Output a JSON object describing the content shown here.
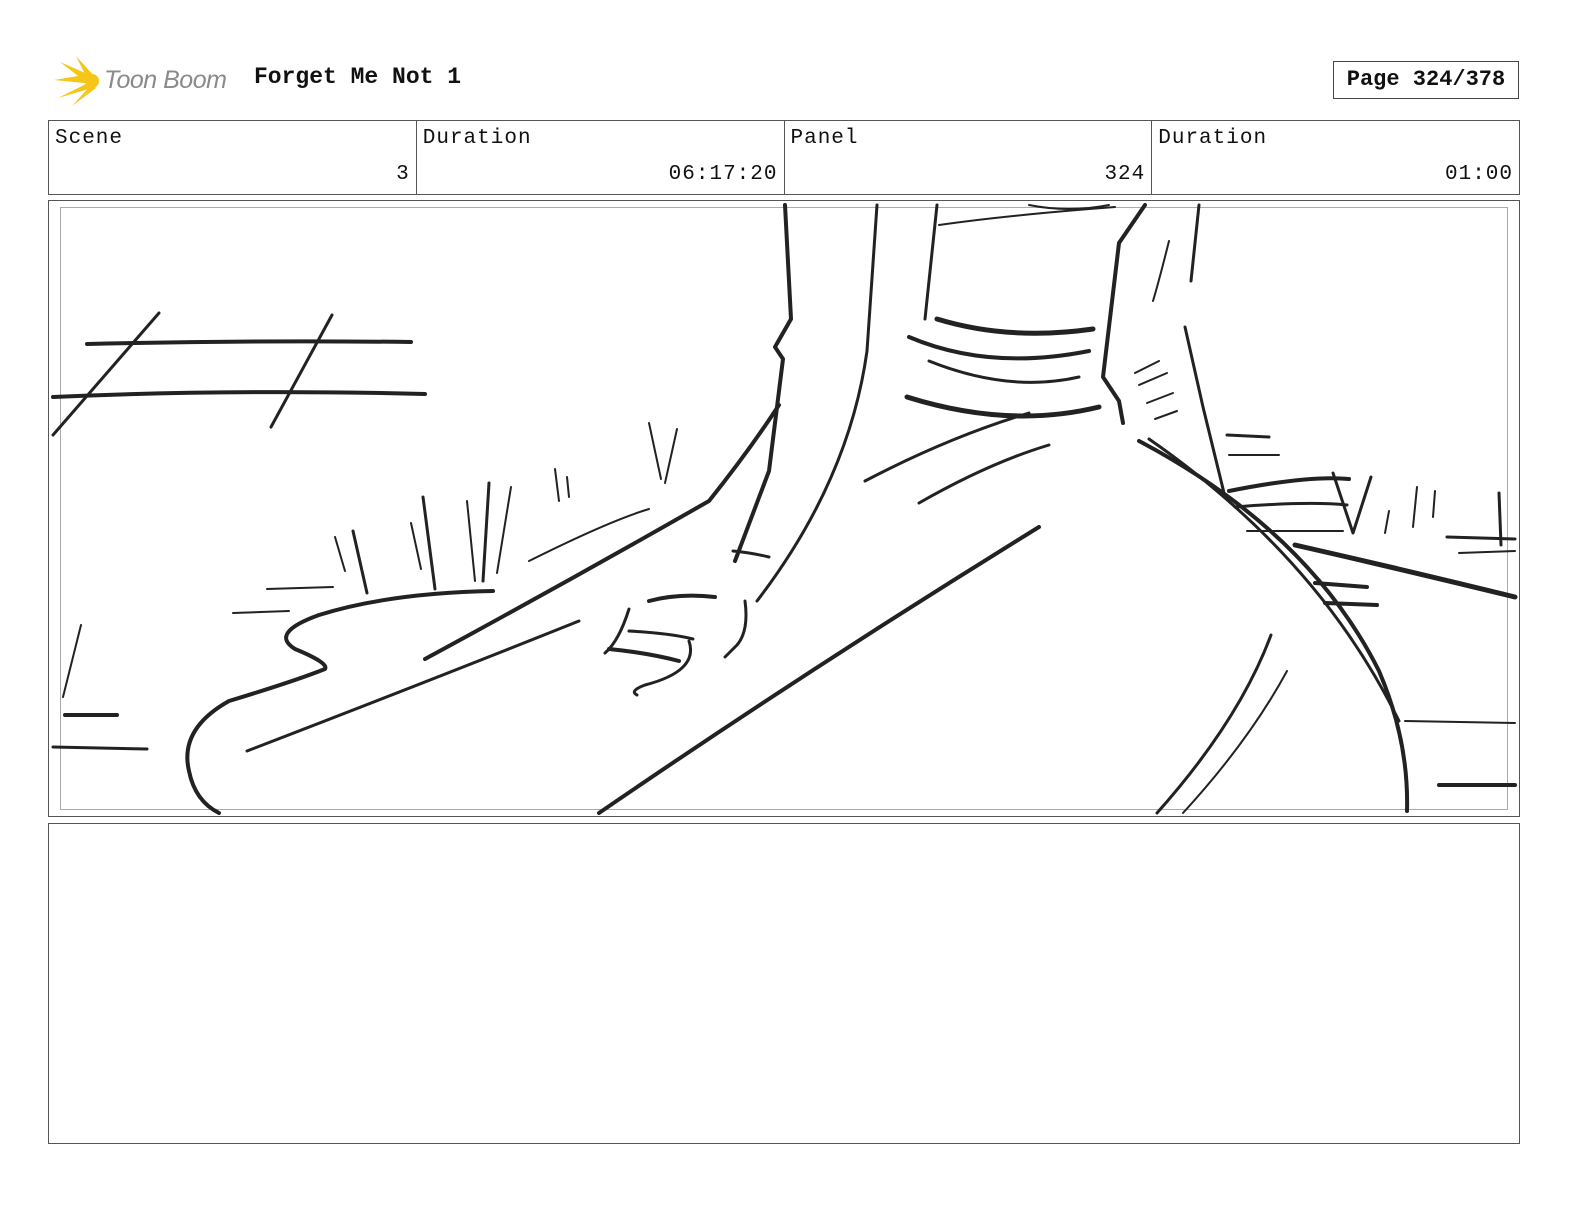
{
  "header": {
    "logo_text": "Toon Boom",
    "project_title": "Forget Me Not 1",
    "page_label": "Page 324/378"
  },
  "info": {
    "scene_label": "Scene",
    "scene_value": "3",
    "scene_duration_label": "Duration",
    "scene_duration_value": "06:17:20",
    "panel_label": "Panel",
    "panel_value": "324",
    "panel_duration_label": "Duration",
    "panel_duration_value": "01:00"
  },
  "colors": {
    "logo_accent": "#f5c518",
    "logo_text": "#8a8a8a",
    "border": "#555555"
  },
  "notes": {
    "text": ""
  }
}
